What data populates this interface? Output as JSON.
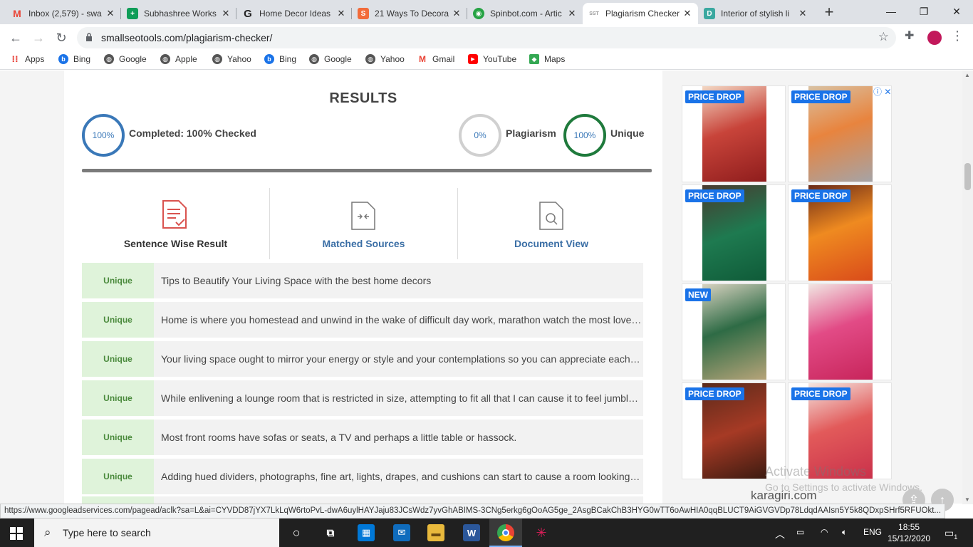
{
  "tabs": [
    {
      "title": "Inbox (2,579) - swa",
      "icon": "gmail-icon",
      "color": "#ea4335"
    },
    {
      "title": "Subhashree Works",
      "icon": "sheets-icon",
      "color": "#0f9d58"
    },
    {
      "title": "Home Decor Ideas",
      "icon": "g-icon",
      "color": "#222222"
    },
    {
      "title": "21 Ways To Decora",
      "icon": "s-icon",
      "color": "#f26b3a"
    },
    {
      "title": "Spinbot.com - Artic",
      "icon": "spinbot-icon",
      "color": "#26a344"
    },
    {
      "title": "Plagiarism Checker",
      "icon": "sst-icon",
      "color": "#999999"
    },
    {
      "title": "Interior of stylish li",
      "icon": "d-icon",
      "color": "#3aa8a0"
    }
  ],
  "address": {
    "url": "smallseotools.com/plagiarism-checker/"
  },
  "bookmarks": [
    "Apps",
    "Bing",
    "Google",
    "Apple",
    "Yahoo",
    "Bing",
    "Google",
    "Yahoo",
    "Gmail",
    "YouTube",
    "Maps"
  ],
  "results": {
    "title": "RESULTS",
    "completed_pct": "100%",
    "completed_label": "Completed: 100% Checked",
    "plagiarism_pct": "0%",
    "plagiarism_label": "Plagiarism",
    "unique_pct": "100%",
    "unique_label": "Unique"
  },
  "tools": [
    {
      "label": "Sentence Wise Result",
      "color": "#333333"
    },
    {
      "label": "Matched Sources",
      "color": "#3a6ea5"
    },
    {
      "label": "Document View",
      "color": "#3a6ea5"
    }
  ],
  "rows": [
    {
      "tag": "Unique",
      "text": "Tips to Beautify Your Living Space with the best home decors"
    },
    {
      "tag": "Unique",
      "text": "Home is where you homestead and unwind in the wake of difficult day work, marathon watch the most loved shows and get together with family and companions."
    },
    {
      "tag": "Unique",
      "text": "Your living space ought to mirror your energy or style and your contemplations so you can appreciate each second spent there."
    },
    {
      "tag": "Unique",
      "text": "While enlivening a lounge room that is restricted in size, attempting to fit all that I can cause it to feel jumbled and awkward."
    },
    {
      "tag": "Unique",
      "text": "Most front rooms have sofas or seats, a TV and perhaps a little table or hassock."
    },
    {
      "tag": "Unique",
      "text": "Adding hued dividers, photographs, fine art, lights, drapes, and cushions can start to cause a room looking cluttered."
    }
  ],
  "ads": {
    "badges": [
      "PRICE DROP",
      "PRICE DROP",
      "PRICE DROP",
      "PRICE DROP",
      "NEW",
      "",
      "PRICE DROP",
      "PRICE DROP"
    ],
    "brand": "karagiri.com",
    "colors": [
      "#b8322a",
      "#e0793a",
      "#1f7a4c",
      "#e8761a",
      "#2e6b45",
      "#d9336b",
      "#a63a25",
      "#d94b4b"
    ]
  },
  "watermark": {
    "line1": "Activate Windows",
    "line2": "Go to Settings to activate Windows."
  },
  "status_url": "https://www.googleadservices.com/pagead/aclk?sa=L&ai=CYVDD87jYX7LkLqW6rtoPvL-dwA6uylHAYJaju83JCsWdz7yvGhABIMS-3CNg5erkg6gOoAG5ge_2AsgBCakChB3HYG0wTT6oAwHIA0qqBLUCT9AiGVGVDp78LdqdAAIsn5Y5k8QDxpSHrf5RFUOkt...",
  "taskbar": {
    "search_placeholder": "Type here to search",
    "lang": "ENG",
    "time": "18:55",
    "date": "15/12/2020",
    "notif_count": "1"
  }
}
